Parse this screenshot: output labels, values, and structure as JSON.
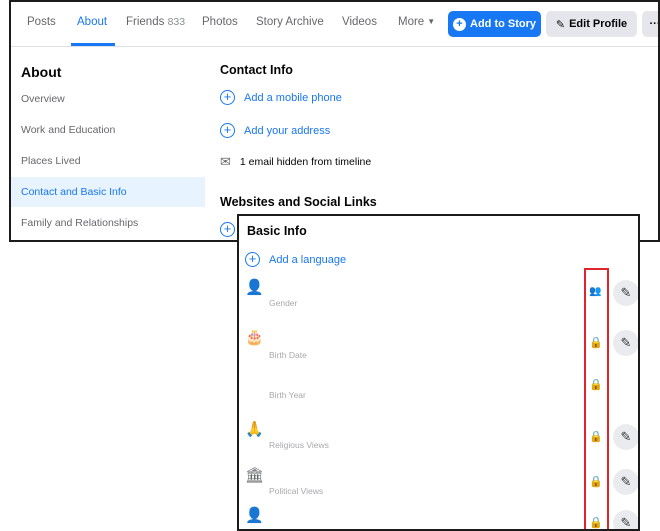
{
  "tabs": [
    {
      "label": "Posts"
    },
    {
      "label": "About"
    },
    {
      "label": "Friends",
      "count": "833"
    },
    {
      "label": "Photos"
    },
    {
      "label": "Story Archive"
    },
    {
      "label": "Videos"
    },
    {
      "label": "More"
    }
  ],
  "header_actions": {
    "add_story": "Add to Story",
    "edit_profile": "Edit Profile",
    "more": "···"
  },
  "sidebar": {
    "title": "About",
    "items": [
      {
        "label": "Overview"
      },
      {
        "label": "Work and Education"
      },
      {
        "label": "Places Lived"
      },
      {
        "label": "Contact and Basic Info",
        "active": true
      },
      {
        "label": "Family and Relationships"
      }
    ]
  },
  "contact": {
    "title": "Contact Info",
    "add_phone": "Add a mobile phone",
    "add_address": "Add your address",
    "email_hidden": "1 email hidden from timeline"
  },
  "websites": {
    "title": "Websites and Social Links"
  },
  "basic_info": {
    "title": "Basic Info",
    "add_language": "Add a language",
    "fields": [
      {
        "label": "Gender",
        "icon": "person-icon",
        "privacy": "friends-icon"
      },
      {
        "label": "Birth Date",
        "icon": "cake-icon",
        "privacy": "lock-icon"
      },
      {
        "label": "Birth Year",
        "icon": "",
        "privacy": "lock-icon"
      },
      {
        "label": "Religious Views",
        "icon": "hands-icon",
        "privacy": "lock-icon"
      },
      {
        "label": "Political Views",
        "icon": "building-icon",
        "privacy": "lock-icon"
      },
      {
        "label": "",
        "icon": "person-icon",
        "privacy": "lock-icon"
      }
    ]
  },
  "colors": {
    "accent": "#1877f2",
    "highlight": "#e0242b",
    "active_bg": "#e7f3ff"
  }
}
